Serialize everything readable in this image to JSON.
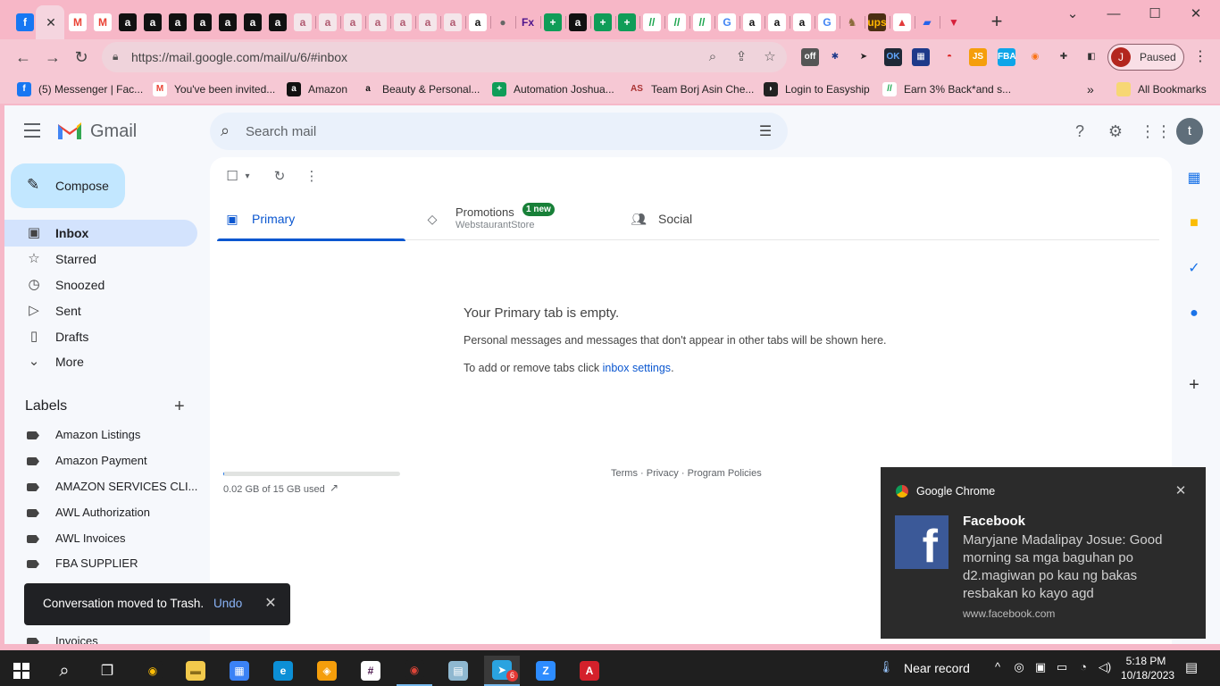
{
  "browser": {
    "tab_favicons": [
      {
        "icon": "facebook-icon",
        "glyph": "f",
        "bg": "#1877f2",
        "fg": "#ffffff"
      },
      {
        "icon": "gmail-icon",
        "glyph": "M",
        "bg": "#ffffff",
        "fg": "#ea4335"
      },
      {
        "icon": "gmail-icon",
        "glyph": "M",
        "bg": "#ffffff",
        "fg": "#ea4335"
      },
      {
        "icon": "amazon-icon",
        "glyph": "a",
        "bg": "#111111",
        "fg": "#ffffff"
      },
      {
        "icon": "amazon-icon",
        "glyph": "a",
        "bg": "#111111",
        "fg": "#ffffff"
      },
      {
        "icon": "amazon-icon",
        "glyph": "a",
        "bg": "#111111",
        "fg": "#ffffff"
      },
      {
        "icon": "amazon-icon",
        "glyph": "a",
        "bg": "#111111",
        "fg": "#ffffff"
      },
      {
        "icon": "amazon-icon",
        "glyph": "a",
        "bg": "#111111",
        "fg": "#ffffff"
      },
      {
        "icon": "amazon-icon",
        "glyph": "a",
        "bg": "#111111",
        "fg": "#ffffff"
      },
      {
        "icon": "amazon-icon",
        "glyph": "a",
        "bg": "#111111",
        "fg": "#ffffff"
      },
      {
        "icon": "amazon-smile-icon",
        "glyph": "a",
        "bg": "#f4e6ea",
        "fg": "#b05a70"
      },
      {
        "icon": "amazon-smile-icon",
        "glyph": "a",
        "bg": "#f4e6ea",
        "fg": "#b05a70"
      },
      {
        "icon": "amazon-smile-icon",
        "glyph": "a",
        "bg": "#f4e6ea",
        "fg": "#b05a70"
      },
      {
        "icon": "amazon-smile-icon",
        "glyph": "a",
        "bg": "#f4e6ea",
        "fg": "#b05a70"
      },
      {
        "icon": "amazon-smile-icon",
        "glyph": "a",
        "bg": "#f4e6ea",
        "fg": "#b05a70"
      },
      {
        "icon": "amazon-smile-icon",
        "glyph": "a",
        "bg": "#f4e6ea",
        "fg": "#b05a70"
      },
      {
        "icon": "amazon-smile-icon",
        "glyph": "a",
        "bg": "#f4e6ea",
        "fg": "#b05a70"
      },
      {
        "icon": "amazon-icon",
        "glyph": "a",
        "bg": "#ffffff",
        "fg": "#111111"
      },
      {
        "icon": "globe-icon",
        "glyph": "●",
        "bg": "#f7b7c7",
        "fg": "#666666"
      },
      {
        "icon": "fedex-icon",
        "glyph": "Fx",
        "bg": "#f7b7c7",
        "fg": "#4d148c"
      },
      {
        "icon": "sheets-plus-icon",
        "glyph": "+",
        "bg": "#0f9d58",
        "fg": "#ffffff"
      },
      {
        "icon": "amazon-icon",
        "glyph": "a",
        "bg": "#111111",
        "fg": "#ffffff"
      },
      {
        "icon": "sheets-plus-icon",
        "glyph": "+",
        "bg": "#0f9d58",
        "fg": "#ffffff"
      },
      {
        "icon": "sheets-plus-icon",
        "glyph": "+",
        "bg": "#0f9d58",
        "fg": "#ffffff"
      },
      {
        "icon": "cashback-icon",
        "glyph": "//",
        "bg": "#ffffff",
        "fg": "#16a34a"
      },
      {
        "icon": "cashback-icon",
        "glyph": "//",
        "bg": "#ffffff",
        "fg": "#16a34a"
      },
      {
        "icon": "cashback-icon",
        "glyph": "//",
        "bg": "#ffffff",
        "fg": "#16a34a"
      },
      {
        "icon": "google-icon",
        "glyph": "G",
        "bg": "#ffffff",
        "fg": "#4285f4"
      },
      {
        "icon": "amazon-icon",
        "glyph": "a",
        "bg": "#ffffff",
        "fg": "#111111"
      },
      {
        "icon": "amazon-icon",
        "glyph": "a",
        "bg": "#ffffff",
        "fg": "#111111"
      },
      {
        "icon": "amazon-icon",
        "glyph": "a",
        "bg": "#ffffff",
        "fg": "#111111"
      },
      {
        "icon": "google-icon",
        "glyph": "G",
        "bg": "#ffffff",
        "fg": "#4285f4"
      },
      {
        "icon": "deer-icon",
        "glyph": "♞",
        "bg": "#f7b7c7",
        "fg": "#8a6a3a"
      },
      {
        "icon": "ups-icon",
        "glyph": "ups",
        "bg": "#4b2e12",
        "fg": "#ffb500"
      },
      {
        "icon": "chart-icon",
        "glyph": "▲",
        "bg": "#ffffff",
        "fg": "#e23b3b"
      },
      {
        "icon": "ext-flag-icon",
        "glyph": "▰",
        "bg": "#f7b7c7",
        "fg": "#2563eb"
      },
      {
        "icon": "shield-v-icon",
        "glyph": "▼",
        "bg": "#f7b7c7",
        "fg": "#d61f3a"
      }
    ],
    "url": "https://mail.google.com/mail/u/6/#inbox",
    "profile_initial": "J",
    "profile_status": "Paused",
    "bookmarks": [
      {
        "icon": "facebook-icon",
        "glyph": "f",
        "bg": "#1877f2",
        "fg": "#ffffff",
        "label": "(5) Messenger | Fac..."
      },
      {
        "icon": "gmail-icon",
        "glyph": "M",
        "bg": "#ffffff",
        "fg": "#ea4335",
        "label": "You've been invited..."
      },
      {
        "icon": "amazon-icon",
        "glyph": "a",
        "bg": "#111111",
        "fg": "#ffffff",
        "label": "Amazon"
      },
      {
        "icon": "amazon-icon",
        "glyph": "a",
        "bg": "#f6c8d4",
        "fg": "#111111",
        "label": "Beauty & Personal..."
      },
      {
        "icon": "sheets-plus-icon",
        "glyph": "+",
        "bg": "#0f9d58",
        "fg": "#ffffff",
        "label": "Automation Joshua..."
      },
      {
        "icon": "team-icon",
        "glyph": "AS",
        "bg": "#f6c8d4",
        "fg": "#a33",
        "label": "Team Borj Asin Che..."
      },
      {
        "icon": "easyship-icon",
        "glyph": "◗",
        "bg": "#222222",
        "fg": "#ffffff",
        "label": "Login to Easyship"
      },
      {
        "icon": "cashback-icon",
        "glyph": "//",
        "bg": "#ffffff",
        "fg": "#16a34a",
        "label": "Earn 3% Back*and s..."
      }
    ],
    "all_bookmarks": "All Bookmarks"
  },
  "gmail": {
    "brand": "Gmail",
    "search_placeholder": "Search mail",
    "account_initial": "t",
    "compose": "Compose",
    "nav": [
      {
        "label": "Inbox",
        "icon": "inbox-icon",
        "glyph": "▣",
        "active": true
      },
      {
        "label": "Starred",
        "icon": "star-icon",
        "glyph": "☆"
      },
      {
        "label": "Snoozed",
        "icon": "clock-icon",
        "glyph": "◷"
      },
      {
        "label": "Sent",
        "icon": "send-icon",
        "glyph": "▷"
      },
      {
        "label": "Drafts",
        "icon": "draft-icon",
        "glyph": "▯"
      },
      {
        "label": "More",
        "icon": "chevron-down-icon",
        "glyph": "⌄"
      }
    ],
    "labels_heading": "Labels",
    "labels": [
      "Amazon Listings",
      "Amazon Payment",
      "AMAZON SERVICES CLI...",
      "AWL Authorization",
      "AWL Invoices",
      "FBA SUPPLIER",
      "Invoices"
    ],
    "tabs": {
      "primary": "Primary",
      "promotions": "Promotions",
      "promotions_badge": "1 new",
      "promotions_sub": "WebstaurantStore",
      "social": "Social"
    },
    "empty": {
      "title": "Your Primary tab is empty.",
      "desc": "Personal messages and messages that don't appear in other tabs will be shown here.",
      "hint_prefix": "To add or remove tabs click ",
      "hint_link": "inbox settings",
      "hint_suffix": "."
    },
    "storage": {
      "used_fraction": 0.0013,
      "text": "0.02 GB of 15 GB used"
    },
    "footer": {
      "terms": "Terms",
      "privacy": "Privacy",
      "policies": "Program Policies",
      "sep": " · "
    },
    "snackbar": {
      "message": "Conversation moved to Trash.",
      "action": "Undo"
    }
  },
  "notification": {
    "app": "Google Chrome",
    "title": "Facebook",
    "body": "Maryjane Madalipay Josue: Good morning sa mga baguhan po d2.magiwan po kau ng bakas resbakan ko kayo agd",
    "source": "www.facebook.com"
  },
  "taskbar": {
    "apps": [
      {
        "icon": "chrome-icon",
        "glyph": "◉",
        "bg": "#1f1f1f",
        "fg": "#fbbc05",
        "running": false
      },
      {
        "icon": "file-explorer-icon",
        "glyph": "▬",
        "bg": "#f2c94c",
        "fg": "#8a6d1a",
        "running": false
      },
      {
        "icon": "network-app-icon",
        "glyph": "▦",
        "bg": "#3b82f6",
        "fg": "#ffffff",
        "running": false
      },
      {
        "icon": "edge-icon",
        "glyph": "e",
        "bg": "#0c8fd6",
        "fg": "#ffffff",
        "running": false
      },
      {
        "icon": "vpn-icon",
        "glyph": "◈",
        "bg": "#f59e0b",
        "fg": "#ffffff",
        "running": false
      },
      {
        "icon": "slack-icon",
        "glyph": "#",
        "bg": "#ffffff",
        "fg": "#4a154b",
        "running": false
      },
      {
        "icon": "chrome-profile-icon",
        "glyph": "◉",
        "bg": "#1f1f1f",
        "fg": "#db4437",
        "running": true
      },
      {
        "icon": "notepad-icon",
        "glyph": "▤",
        "bg": "#8fb8d0",
        "fg": "#ffffff",
        "running": false
      },
      {
        "icon": "telegram-icon",
        "glyph": "➤",
        "bg": "#2aa3e0",
        "fg": "#ffffff",
        "running": true,
        "badge": "6"
      },
      {
        "icon": "zoom-icon",
        "glyph": "Z",
        "bg": "#2d8cff",
        "fg": "#ffffff",
        "running": false
      },
      {
        "icon": "acrobat-icon",
        "glyph": "A",
        "bg": "#d4212b",
        "fg": "#ffffff",
        "running": false
      }
    ],
    "weather": "Near record",
    "time": "5:18 PM",
    "date": "10/18/2023"
  }
}
